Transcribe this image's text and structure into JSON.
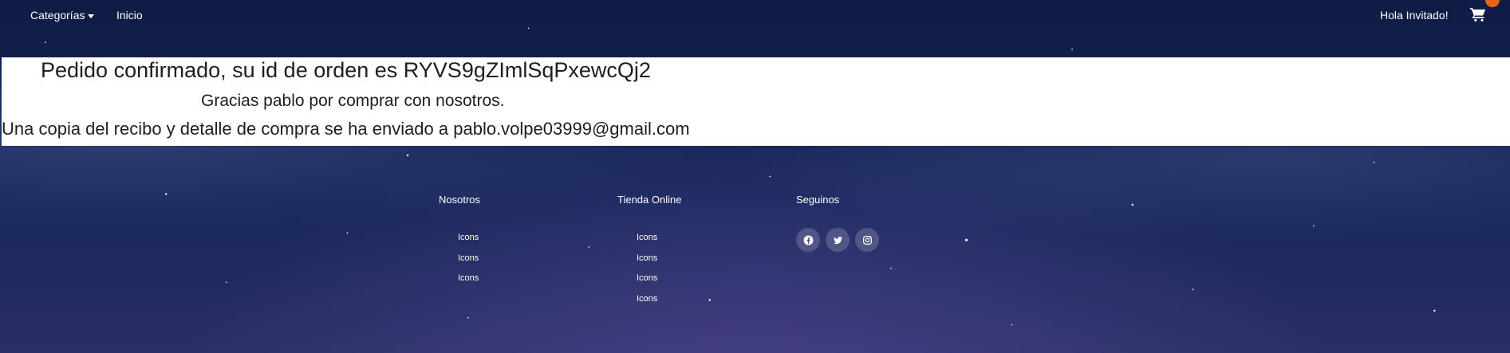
{
  "navbar": {
    "categorias_label": "Categorías",
    "inicio_label": "Inicio",
    "greeting": "Hola Invitado!",
    "cart_icon": "shopping-cart-icon",
    "cart_badge_color": "#e8631a"
  },
  "confirmation": {
    "title": "Pedido confirmado, su id de orden es RYVS9gZImlSqPxewcQj2",
    "thanks": "Gracias pablo por comprar con nosotros.",
    "copy_notice": "Una copia del recibo y detalle de compra se ha enviado a pablo.volpe03999@gmail.com"
  },
  "footer": {
    "nosotros": {
      "heading": "Nosotros",
      "links": [
        "Icons",
        "Icons",
        "Icons"
      ]
    },
    "tienda": {
      "heading": "Tienda Online",
      "links": [
        "Icons",
        "Icons",
        "Icons",
        "Icons"
      ]
    },
    "seguinos": {
      "heading": "Seguinos",
      "social_icons": [
        "facebook-icon",
        "twitter-icon",
        "instagram-icon"
      ]
    }
  }
}
